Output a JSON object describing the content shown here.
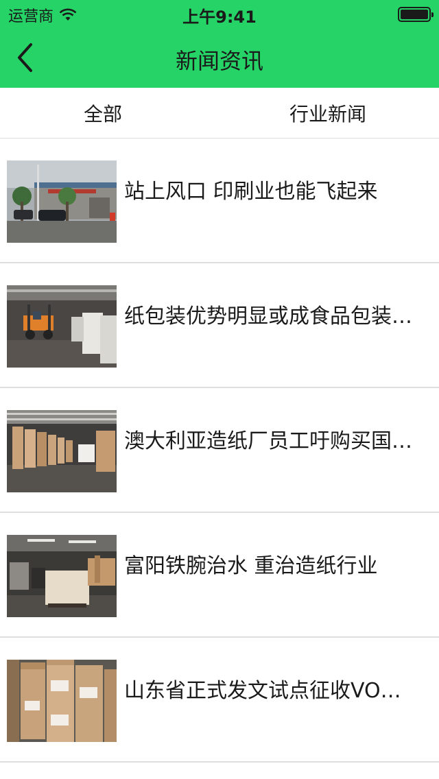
{
  "status_bar": {
    "carrier": "运营商",
    "time": "上午9:41",
    "icons": [
      "wifi-icon",
      "battery-icon"
    ]
  },
  "nav": {
    "back_icon": "chevron-left-icon",
    "title": "新闻资讯"
  },
  "colors": {
    "header": "#25d366",
    "divider": "#dedede"
  },
  "tabs": [
    {
      "label": "全部"
    },
    {
      "label": "行业新闻"
    }
  ],
  "news": [
    {
      "title": "站上风口 印刷业也能飞起来",
      "image": "factory-exterior"
    },
    {
      "title": "纸包装优势明显或成食品包装…",
      "image": "forklift-warehouse"
    },
    {
      "title": "澳大利亚造纸厂员工吁购买国…",
      "image": "paper-rolls-warehouse"
    },
    {
      "title": "富阳铁腕治水 重治造纸行业",
      "image": "paper-stacks-warehouse"
    },
    {
      "title": "山东省正式发文试点征收VO…",
      "image": "kraft-paper-rolls"
    }
  ]
}
